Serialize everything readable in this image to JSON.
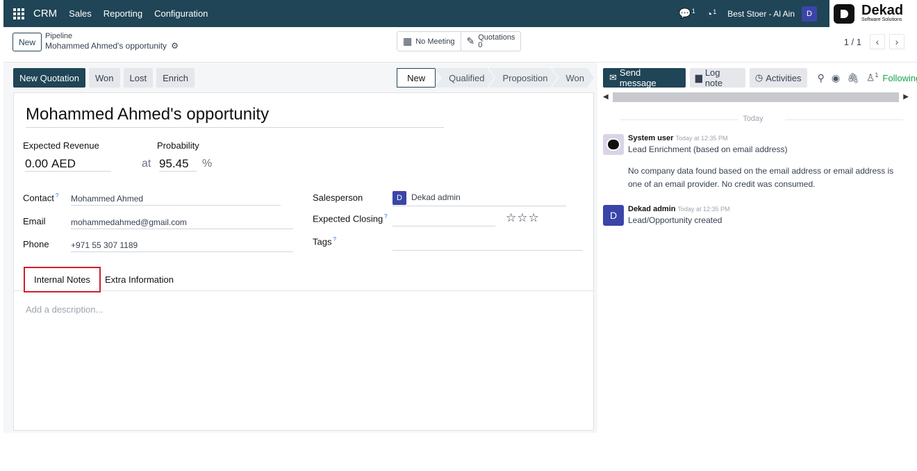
{
  "navbar": {
    "app_name": "CRM",
    "menu": [
      "Sales",
      "Reporting",
      "Configuration"
    ],
    "messages_count": "1",
    "activities_count": "1",
    "company": "Best Stoer - Al Ain",
    "user_initial": "D",
    "logo_name": "Dekad",
    "logo_sub": "Software Solutions"
  },
  "control": {
    "new_label": "New",
    "breadcrumb_parent": "Pipeline",
    "breadcrumb_current": "Mohammed Ahmed's opportunity",
    "meeting_label": "No Meeting",
    "quotations_label": "Quotations",
    "quotations_count": "0",
    "pager": "1 / 1"
  },
  "statusbar": {
    "new_quotation": "New Quotation",
    "won": "Won",
    "lost": "Lost",
    "enrich": "Enrich",
    "stages": [
      "New",
      "Qualified",
      "Proposition",
      "Won"
    ],
    "active_stage": "New"
  },
  "form": {
    "title": "Mohammed Ahmed's opportunity",
    "expected_revenue_label": "Expected Revenue",
    "expected_revenue_value": "0.00",
    "currency": "AED",
    "at_label": "at",
    "probability_label": "Probability",
    "probability_value": "95.45",
    "percent": "%",
    "contact_label": "Contact",
    "contact_value": "Mohammed Ahmed",
    "email_label": "Email",
    "email_value": "mohammedahmed@gmail.com",
    "phone_label": "Phone",
    "phone_value": "+971 55 307 1189",
    "salesperson_label": "Salesperson",
    "salesperson_initial": "D",
    "salesperson_value": "Dekad admin",
    "expected_closing_label": "Expected Closing",
    "tags_label": "Tags",
    "help_mark": "?",
    "priority_stars": "☆☆☆",
    "tabs": [
      "Internal Notes",
      "Extra Information"
    ],
    "description_placeholder": "Add a description..."
  },
  "chatter": {
    "send_message": "Send message",
    "log_note": "Log note",
    "activities": "Activities",
    "followers_count": "1",
    "following": "Following",
    "today": "Today",
    "messages": [
      {
        "author": "System user",
        "time": "Today at 12:35 PM",
        "text": "Lead Enrichment (based on email address)",
        "extra": "No company data found based on the email address or email address is one of an email provider. No credit was consumed."
      },
      {
        "author": "Dekad admin",
        "initial": "D",
        "time": "Today at 12:35 PM",
        "text": "Lead/Opportunity created"
      }
    ]
  }
}
